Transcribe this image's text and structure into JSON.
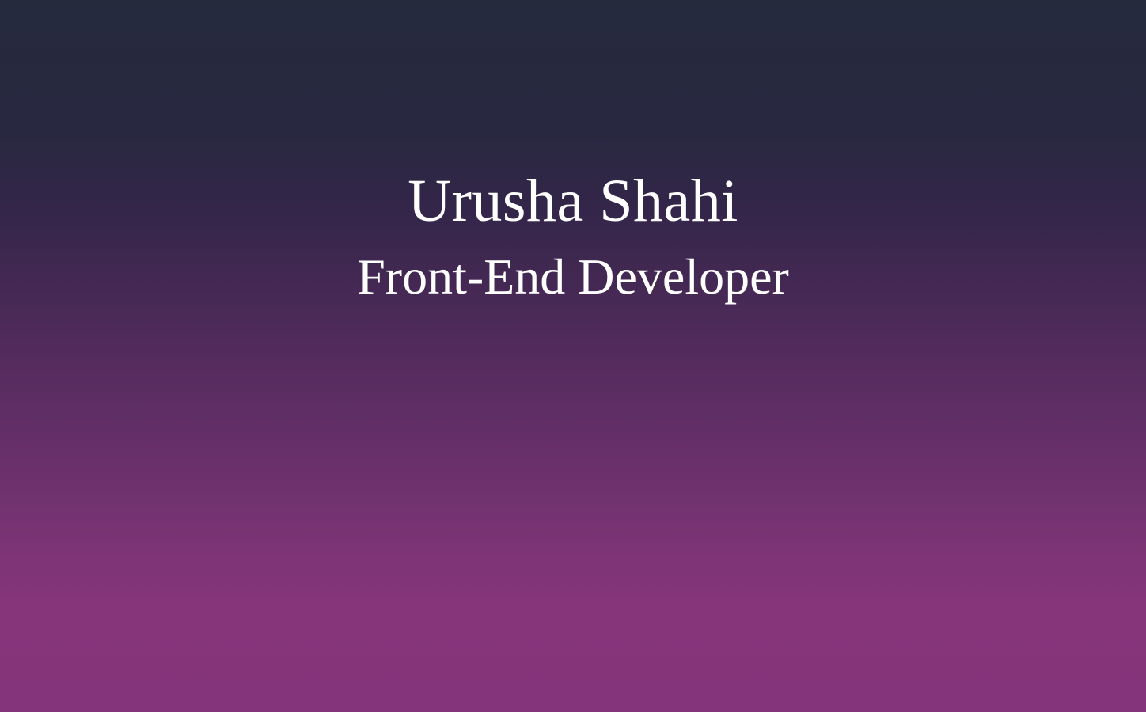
{
  "hero": {
    "name": "Urusha Shahi",
    "role": "Front-End Developer"
  },
  "colors": {
    "gradient_top": "#252a3d",
    "gradient_bottom": "#86357b",
    "text": "#ffffff"
  }
}
